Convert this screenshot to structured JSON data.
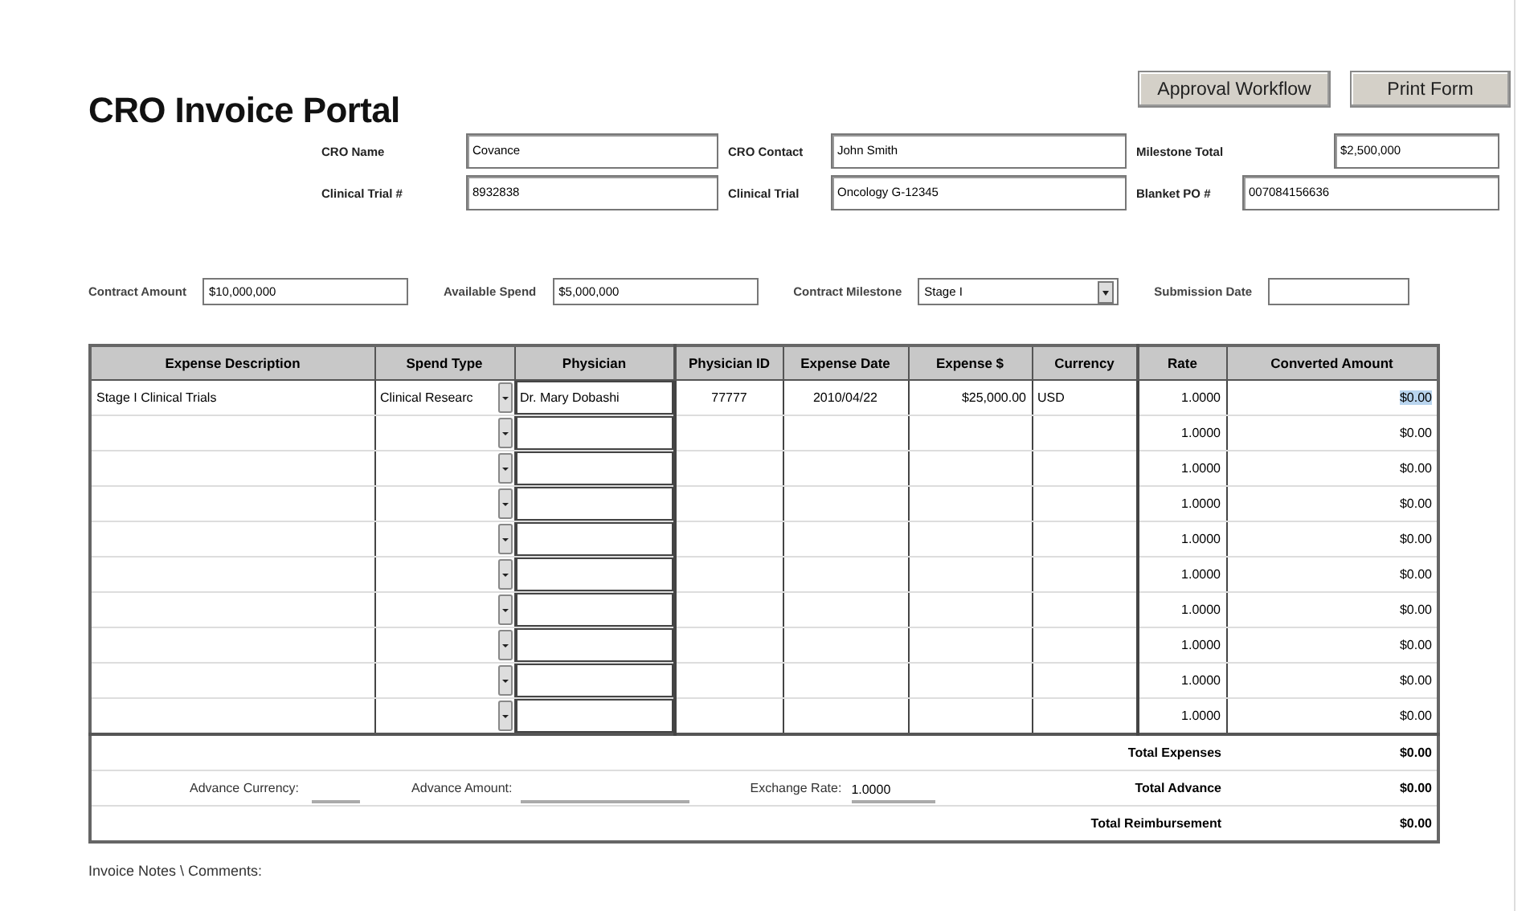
{
  "title": "CRO Invoice Portal",
  "buttons": [
    "Approval Workflow",
    "Print Form"
  ],
  "header_fields": [
    {
      "label": "CRO Name",
      "value": "Covance"
    },
    {
      "label": "CRO Contact",
      "value": "John Smith"
    },
    {
      "label": "Milestone Total",
      "value": "$2,500,000"
    },
    {
      "label": "Clinical Trial #",
      "value": "8932838"
    },
    {
      "label": "Clinical Trial",
      "value": "Oncology G-12345"
    },
    {
      "label": "Blanket PO #",
      "value": "007084156636"
    }
  ],
  "contract_fields": [
    {
      "kind": "text",
      "label": "Contract Amount",
      "value": "$10,000,000"
    },
    {
      "kind": "text",
      "label": "Available Spend",
      "value": "$5,000,000"
    },
    {
      "kind": "select",
      "label": "Contract Milestone",
      "value": "Stage I"
    },
    {
      "kind": "text",
      "label": "Submission Date"
    }
  ],
  "table": {
    "columns": [
      "Expense Description",
      "Spend Type",
      "Physician",
      "Physician ID",
      "Expense Date",
      "Expense $",
      "Currency",
      "Rate",
      "Converted Amount"
    ],
    "rows": [
      {
        "description": "Stage I Clinical Trials",
        "spend_type": "Clinical Researc",
        "physician": "Dr. Mary Dobashi",
        "physician_id": "77777",
        "expense_date": "2010/04/22",
        "expense": "$25,000.00",
        "currency": "USD",
        "rate": "1.0000",
        "converted": "$0.00",
        "selected": true
      },
      {
        "rate": "1.0000",
        "converted": "$0.00",
        "selected": false
      },
      {
        "rate": "1.0000",
        "converted": "$0.00",
        "selected": false
      },
      {
        "rate": "1.0000",
        "converted": "$0.00",
        "selected": false
      },
      {
        "rate": "1.0000",
        "converted": "$0.00",
        "selected": false
      },
      {
        "rate": "1.0000",
        "converted": "$0.00",
        "selected": false
      },
      {
        "rate": "1.0000",
        "converted": "$0.00",
        "selected": false
      },
      {
        "rate": "1.0000",
        "converted": "$0.00",
        "selected": false
      },
      {
        "rate": "1.0000",
        "converted": "$0.00",
        "selected": false
      },
      {
        "rate": "1.0000",
        "converted": "$0.00",
        "selected": false
      }
    ]
  },
  "advance": {
    "currency_label": "Advance Currency:",
    "amount_label": "Advance Amount:",
    "rate_label": "Exchange Rate:",
    "rate_value": "1.0000"
  },
  "totals": [
    {
      "label": "Total Expenses",
      "value": "$0.00"
    },
    {
      "label": "Total Advance",
      "value": "$0.00"
    },
    {
      "label": "Total Reimbursement",
      "value": "$0.00"
    }
  ],
  "notes_label": "Invoice Notes \\ Comments:"
}
